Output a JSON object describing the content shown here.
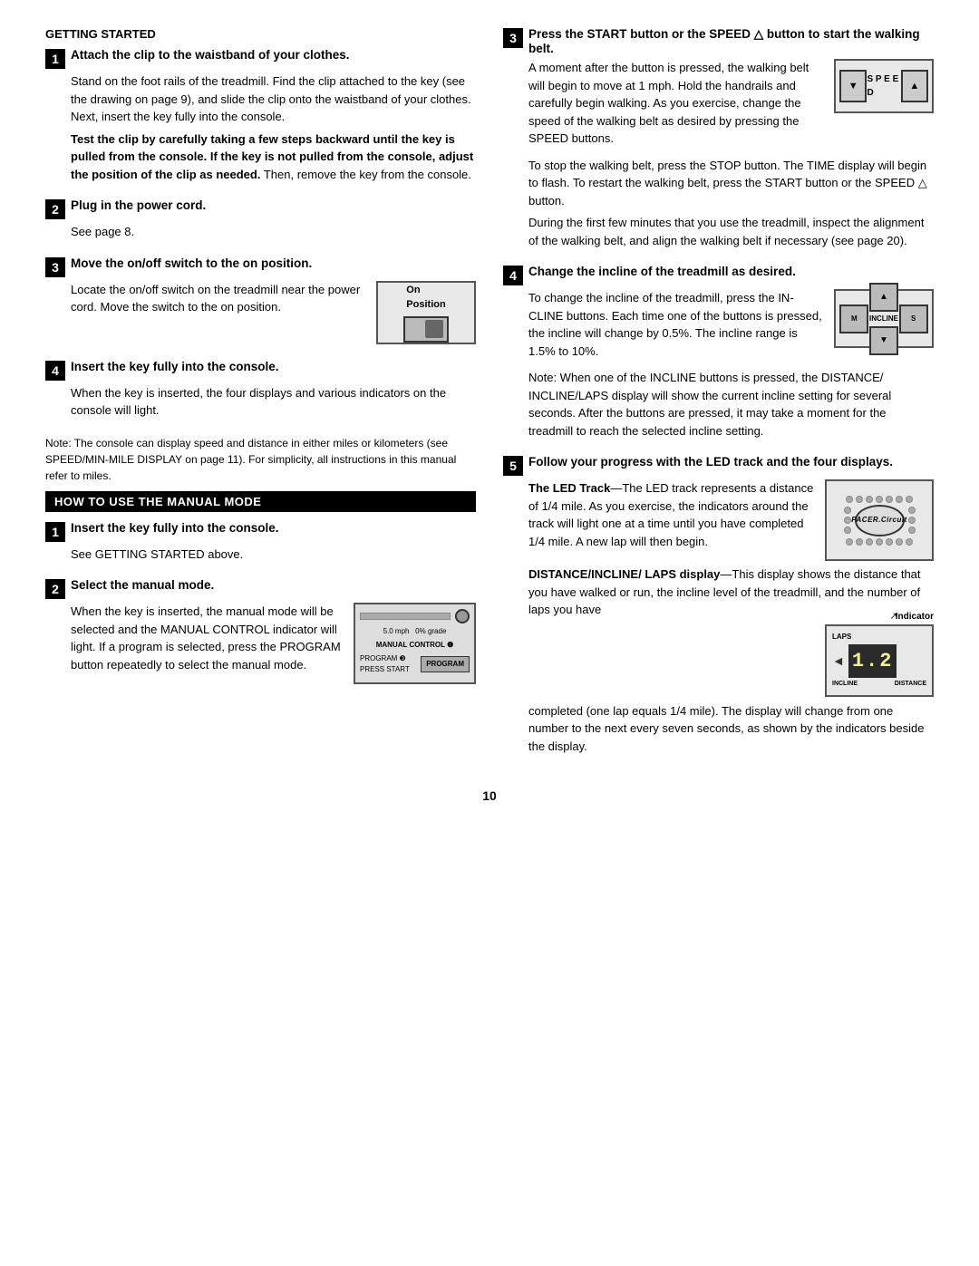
{
  "page": {
    "number": "10"
  },
  "sections": {
    "getting_started": {
      "header": "GETTING STARTED",
      "steps": [
        {
          "number": "1",
          "title": "Attach the clip to the waistband of your clothes.",
          "body_paragraphs": [
            "Stand on the foot rails of the treadmill. Find the clip attached to the key (see the drawing on page 9), and slide the clip onto the waistband of your clothes. Next, insert the key fully into the console.",
            "Test the clip by carefully taking a few steps backward until the key is pulled from the console. If the key is not pulled from the console, adjust the position of the clip as needed.",
            "Then, remove the key from the console."
          ],
          "bold_sentence": "Test the clip by carefully taking a few steps backward until the key is pulled from the console. If the key is not pulled from the console, adjust the position of the clip as needed."
        },
        {
          "number": "2",
          "title": "Plug in the power cord.",
          "body": "See page 8."
        },
        {
          "number": "3",
          "title": "Move the on/off switch to the on position.",
          "body": "Locate the on/off switch on the treadmill near the power cord. Move the switch to the on position.",
          "figure_label": "On Position"
        },
        {
          "number": "4",
          "title": "Insert the key fully into the console.",
          "body": "When the key is inserted, the four displays and various indicators on the console will light."
        }
      ],
      "note": "Note: The console can display speed and distance in either miles or kilometers (see SPEED/MIN-MILE DISPLAY on page 11). For simplicity, all instructions in this manual refer to miles."
    },
    "manual_mode": {
      "header": "HOW TO USE THE MANUAL MODE",
      "steps": [
        {
          "number": "1",
          "title": "Insert the key fully into the console.",
          "body": "See GETTING STARTED above."
        },
        {
          "number": "2",
          "title": "Select the manual mode.",
          "body_parts": [
            "When the key is inserted, the manual mode will be selected and the MANUAL CONTROL indicator will light. If a program is selected, press the PROGRAM button repeatedly to select the manual mode."
          ],
          "fig_text": {
            "speed": "5.0 mph 0% grade",
            "manual_control": "MANUAL CONTROL",
            "program_label": "PROGRAM ❸ PRESS START",
            "program_btn": "PROGRAM"
          }
        }
      ]
    },
    "right_col": {
      "step3": {
        "number": "3",
        "title": "Press the START button or the SPEED △ button to start the walking belt.",
        "body_paragraphs": [
          "A moment after the button is pressed, the walking belt will begin to move at 1 mph. Hold the handrails and carefully begin walking. As you exercise, change the speed of the walking belt as desired by pressing the SPEED buttons.",
          "To stop the walking belt, press the STOP button. The TIME display will begin to flash. To restart the walking belt, press the START button or the SPEED △ button.",
          "During the first few minutes that you use the treadmill, inspect the alignment of the walking belt, and align the walking belt if necessary (see page 20)."
        ],
        "speed_fig": {
          "down_label": "▼",
          "center_label": "SPEED",
          "up_label": "▲"
        }
      },
      "step4": {
        "number": "4",
        "title": "Change the incline of the treadmill as desired.",
        "body_paragraphs": [
          "To change the incline of the treadmill, press the INCLINE buttons. Each time one of the buttons is pressed, the incline will change by 0.5%. The incline range is 1.5% to 10%.",
          "Note: When one of the INCLINE buttons is pressed, the DISTANCE/ INCLINE/LAPS display will show the current incline setting for several seconds. After the buttons are pressed, it may take a moment for the treadmill to reach the selected incline setting."
        ],
        "incline_fig": {
          "left_label": "M",
          "center_label": "▲ INCLINE ▼",
          "right_label": "S"
        }
      },
      "step5": {
        "number": "5",
        "title": "Follow your progress with the LED track and the four displays.",
        "led_track": {
          "label": "The LED Track",
          "body": "The LED track represents a distance of 1/4 mile. As you exercise, the indicators around the track will light one at a time until you have completed 1/4 mile. A new lap will then begin.",
          "center_text": "PACER.Circuit"
        },
        "dil_display": {
          "label": "DISTANCE/INCLINE/ LAPS display",
          "body_parts": [
            "This display shows the distance that you have walked or run, the incline level of the treadmill, and the number of laps you have completed (one lap equals 1/4 mile). The display will change from one number to the next every seven seconds, as shown by the indicators beside the display."
          ],
          "top_label": "LAPS",
          "indicator_label": "Indicator",
          "display_value": "1.2",
          "bottom_left": "INCLINE",
          "bottom_right": "DISTANCE"
        }
      }
    }
  }
}
